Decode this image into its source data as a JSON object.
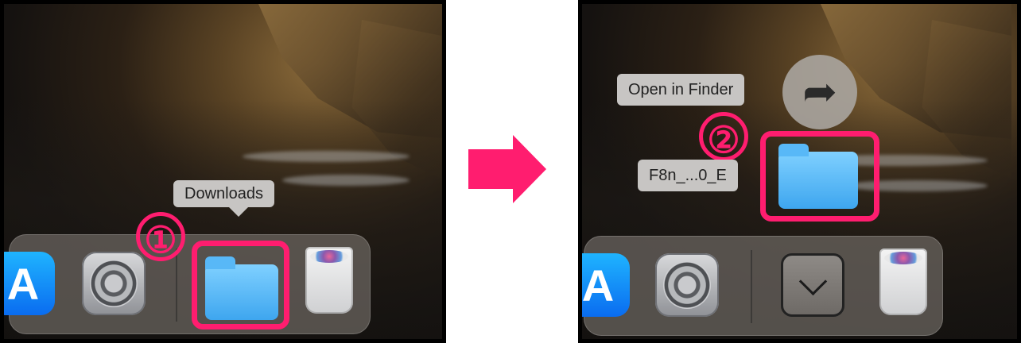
{
  "left_panel": {
    "tooltip": "Downloads",
    "step": "①",
    "dock_items": [
      "app-store-icon",
      "system-settings-icon",
      "downloads-folder-icon",
      "trash-icon"
    ]
  },
  "right_panel": {
    "open_in_finder_label": "Open in Finder",
    "file_label": "F8n_...0_E",
    "step": "②",
    "dock_items": [
      "app-store-icon",
      "system-settings-icon",
      "chevron-down-icon",
      "trash-icon"
    ]
  },
  "icons": {
    "app_store_glyph": "A",
    "open_arrow_glyph": "➦"
  },
  "colors": {
    "highlight": "#ff1d6f",
    "folder_blue": "#3ea6ef",
    "tooltip_bg": "#c7c5c3"
  }
}
